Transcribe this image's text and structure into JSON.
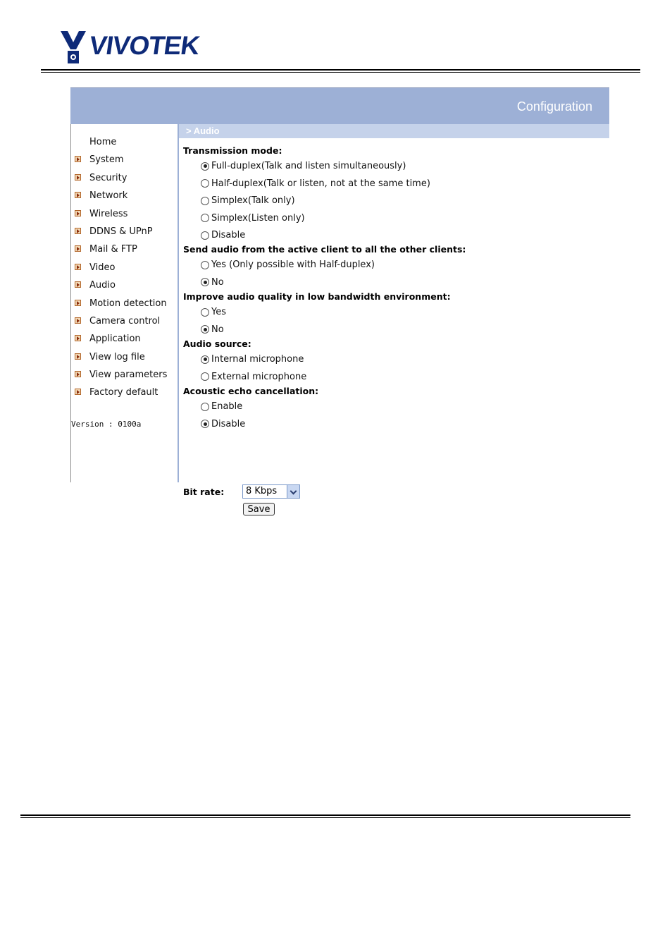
{
  "brand": {
    "logo_text": "VIVOTEK",
    "brand_color": "#0e2a78"
  },
  "header": {
    "title": "Configuration",
    "band_color": "#9db0d6"
  },
  "breadcrumb": "> Audio",
  "sidebar": {
    "items": [
      {
        "label": "Home",
        "icon": "none"
      },
      {
        "label": "System",
        "icon": "arrow-icon"
      },
      {
        "label": "Security",
        "icon": "arrow-icon"
      },
      {
        "label": "Network",
        "icon": "arrow-icon"
      },
      {
        "label": "Wireless",
        "icon": "arrow-icon"
      },
      {
        "label": "DDNS & UPnP",
        "icon": "arrow-icon"
      },
      {
        "label": "Mail & FTP",
        "icon": "arrow-icon"
      },
      {
        "label": "Video",
        "icon": "arrow-icon"
      },
      {
        "label": "Audio",
        "icon": "arrow-icon"
      },
      {
        "label": "Motion detection",
        "icon": "arrow-icon"
      },
      {
        "label": "Camera control",
        "icon": "arrow-icon"
      },
      {
        "label": "Application",
        "icon": "arrow-icon"
      },
      {
        "label": "View log file",
        "icon": "arrow-icon"
      },
      {
        "label": "View parameters",
        "icon": "arrow-icon"
      },
      {
        "label": "Factory default",
        "icon": "arrow-icon"
      }
    ],
    "version": "Version : 0100a"
  },
  "audio": {
    "transmission": {
      "title": "Transmission mode:",
      "options": [
        {
          "label": "Full-duplex(Talk and listen simultaneously)",
          "checked": true
        },
        {
          "label": "Half-duplex(Talk or listen, not at the same time)",
          "checked": false
        },
        {
          "label": "Simplex(Talk only)",
          "checked": false
        },
        {
          "label": "Simplex(Listen only)",
          "checked": false
        },
        {
          "label": "Disable",
          "checked": false
        }
      ]
    },
    "send_audio": {
      "title": "Send audio from the active client to all the other clients:",
      "options": [
        {
          "label": "Yes (Only possible with Half-duplex)",
          "checked": false
        },
        {
          "label": "No",
          "checked": true
        }
      ]
    },
    "improve_quality": {
      "title": "Improve audio quality in low bandwidth environment:",
      "options": [
        {
          "label": "Yes",
          "checked": false
        },
        {
          "label": "No",
          "checked": true
        }
      ]
    },
    "source": {
      "title": "Audio source:",
      "options": [
        {
          "label": "Internal microphone",
          "checked": true
        },
        {
          "label": "External microphone",
          "checked": false
        }
      ]
    },
    "echo": {
      "title": "Acoustic echo cancellation:",
      "options": [
        {
          "label": "Enable",
          "checked": false
        },
        {
          "label": "Disable",
          "checked": true
        }
      ]
    },
    "bitrate": {
      "label": "Bit rate:",
      "value": "8 Kbps"
    },
    "save_label": "Save"
  }
}
